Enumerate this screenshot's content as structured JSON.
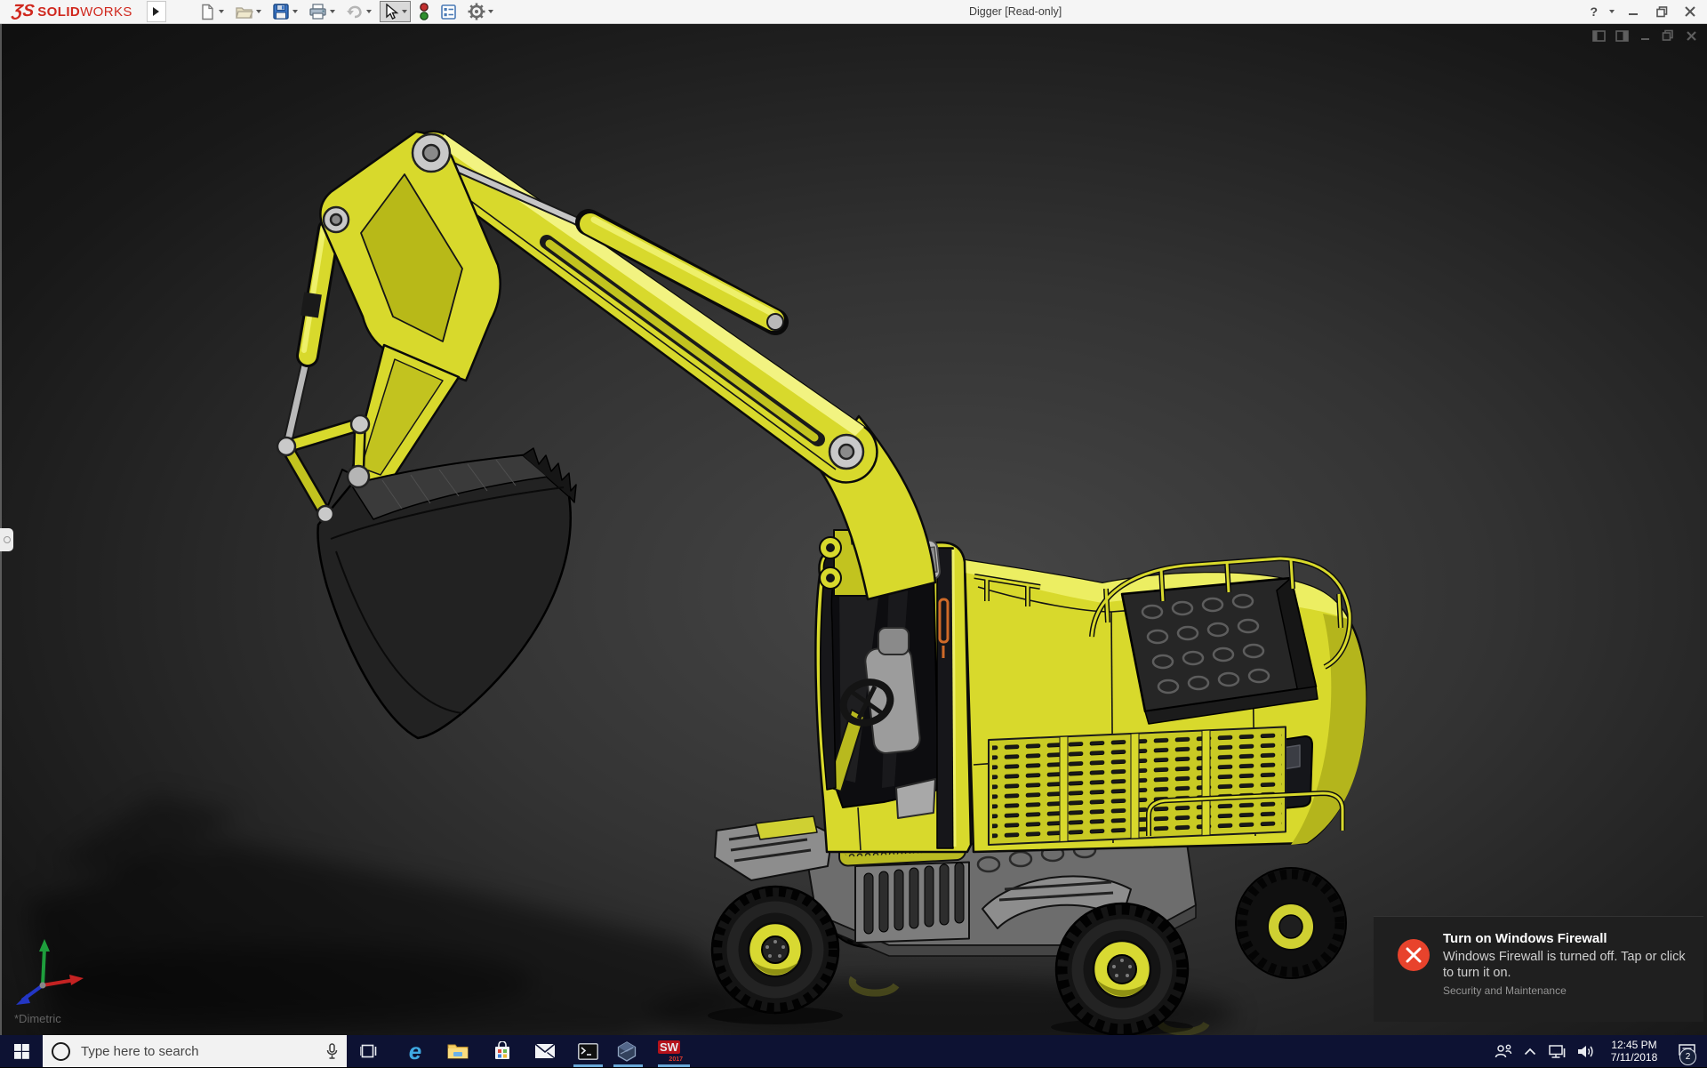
{
  "window": {
    "title": "Digger [Read-only]",
    "help_label": "?"
  },
  "brand": {
    "mark": "ƷS",
    "solid": "SOLID",
    "works": "WORKS"
  },
  "toolbar": {
    "buttons": [
      "new-document",
      "open",
      "save",
      "print",
      "undo",
      "select",
      "view-traffic-light",
      "display-settings",
      "options-gear"
    ]
  },
  "viewport": {
    "view_orientation_label": "*Dimetric",
    "model_name": "Digger"
  },
  "notification": {
    "title": "Turn on Windows Firewall",
    "body": "Windows Firewall is turned off. Tap or click to turn it on.",
    "source": "Security and Maintenance"
  },
  "taskbar": {
    "search_placeholder": "Type here to search",
    "solidworks_label": "SW",
    "solidworks_year": "2017",
    "icons": [
      "start",
      "task-view",
      "edge",
      "file-explorer",
      "store",
      "mail",
      "command-prompt",
      "edrawings",
      "solidworks-2017"
    ],
    "tray": {
      "time": "12:45 PM",
      "date": "7/11/2018",
      "badge_count": "2"
    }
  },
  "colors": {
    "brand_red": "#d0281e",
    "accent_blue": "#6aa9d8",
    "excavator_yellow": "#d8d92c",
    "error_red": "#e8432c",
    "taskbar_bg": "#0d1233"
  }
}
